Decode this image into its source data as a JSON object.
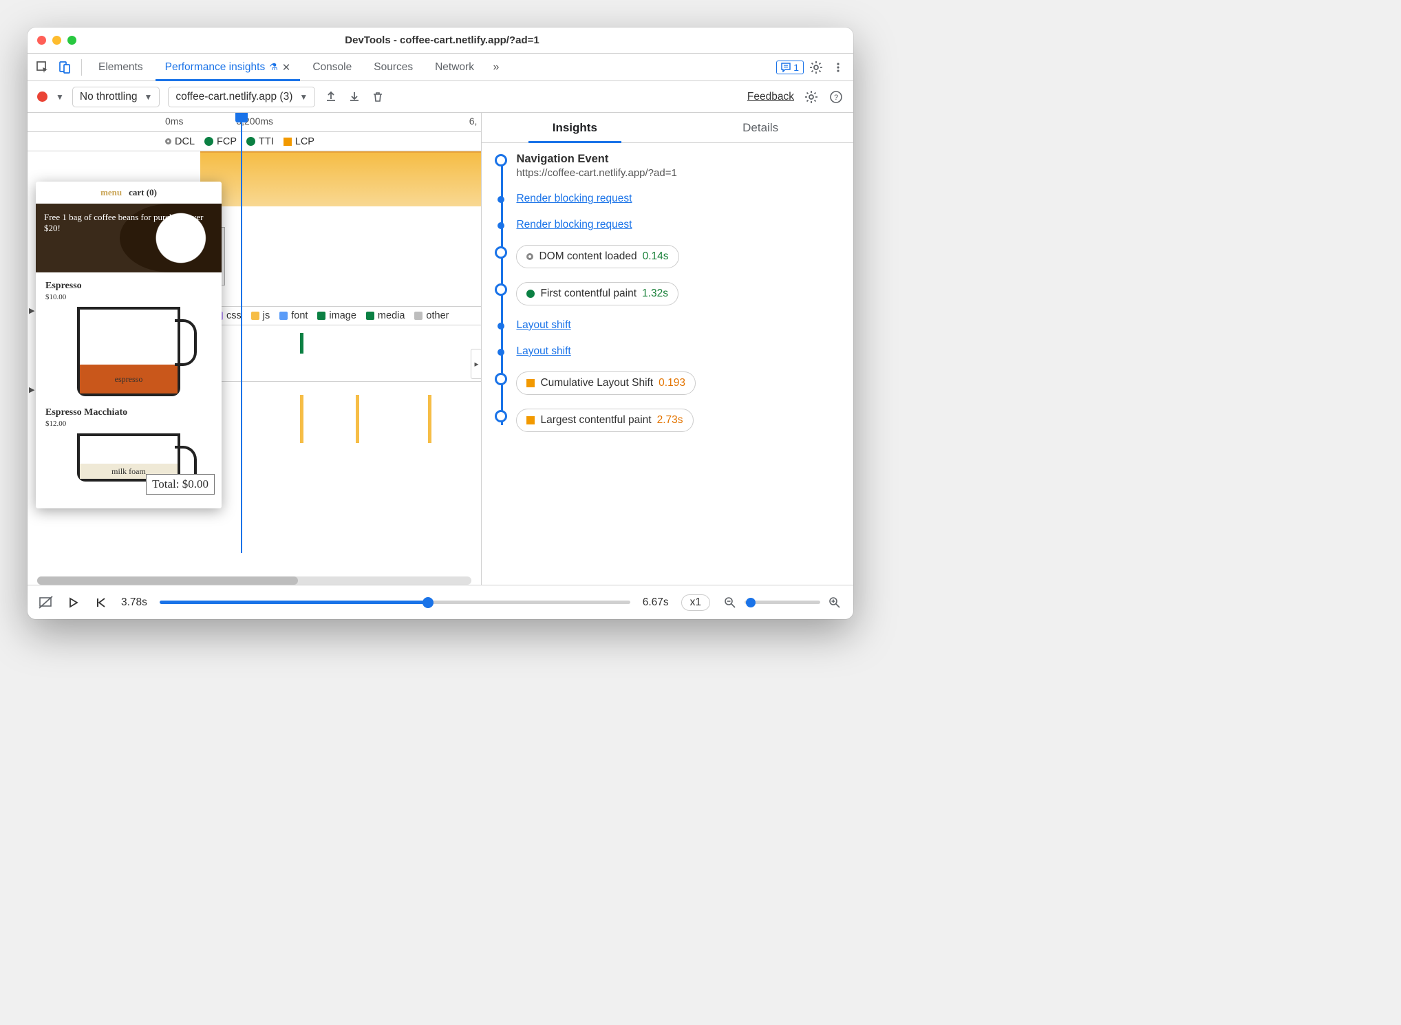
{
  "window": {
    "title": "DevTools - coffee-cart.netlify.app/?ad=1"
  },
  "tabs": {
    "items": [
      "Elements",
      "Performance insights",
      "Console",
      "Sources",
      "Network"
    ],
    "active_index": 1,
    "issues_count": "1"
  },
  "toolbar": {
    "throttle": "No throttling",
    "recording": "coffee-cart.netlify.app (3)",
    "feedback": "Feedback"
  },
  "ruler": {
    "t0": "0ms",
    "t1": "3,200ms",
    "t2": "6,"
  },
  "markers": {
    "dcl": "DCL",
    "fcp": "FCP",
    "tti": "TTI",
    "lcp": "LCP"
  },
  "legend": {
    "css": "css",
    "js": "js",
    "font": "font",
    "image": "image",
    "media": "media",
    "other": "other"
  },
  "filmstrip": {
    "menu": "menu",
    "cart": "cart (0)",
    "banner": "Free 1 bag of coffee beans for purchase over $20!",
    "item1_name": "Espresso",
    "item1_price": "$10.00",
    "item1_label": "espresso",
    "item2_name": "Espresso Macchiato",
    "item2_price": "$12.00",
    "item2_label": "milk foam",
    "total": "Total: $0.00"
  },
  "insights_tabs": {
    "insights": "Insights",
    "details": "Details"
  },
  "insights": {
    "nav_title": "Navigation Event",
    "nav_url": "https://coffee-cart.netlify.app/?ad=1",
    "rbr": "Render blocking request",
    "dcl_label": "DOM content loaded",
    "dcl_val": "0.14s",
    "fcp_label": "First contentful paint",
    "fcp_val": "1.32s",
    "ls": "Layout shift",
    "cls_label": "Cumulative Layout Shift",
    "cls_val": "0.193",
    "lcp_label": "Largest contentful paint",
    "lcp_val": "2.73s"
  },
  "footer": {
    "current": "3.78s",
    "total": "6.67s",
    "speed": "x1"
  }
}
